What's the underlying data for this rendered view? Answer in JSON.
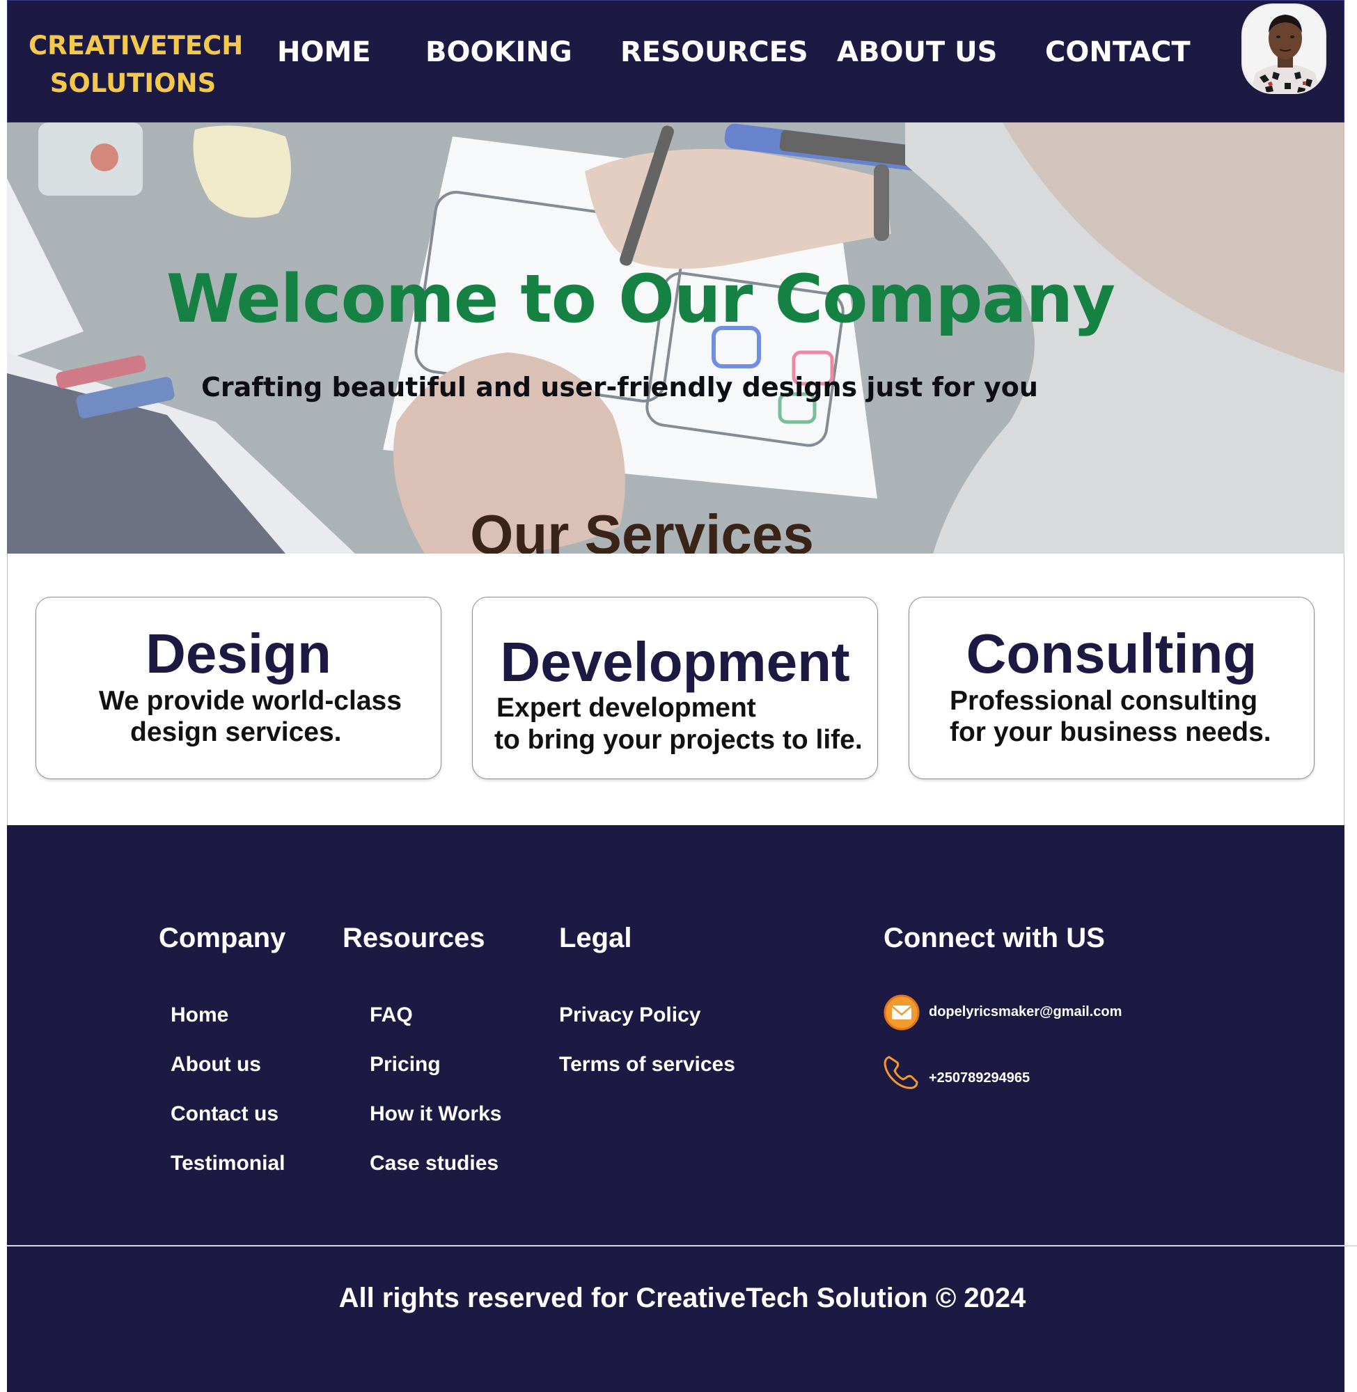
{
  "header": {
    "logo_line1": "CREATIVETECH",
    "logo_line2": "SOLUTIONS",
    "nav": [
      "HOME",
      "BOOKING",
      "RESOURCES",
      "ABOUT US",
      "CONTACT"
    ]
  },
  "hero": {
    "title": "Welcome to Our Company",
    "subtitle": "Crafting beautiful and user-friendly designs just for you"
  },
  "services": {
    "heading": "Our Services",
    "cards": [
      {
        "title": "Design",
        "desc_line1": "We provide world-class",
        "desc_line2": "design services."
      },
      {
        "title": "Development",
        "desc_line1": "Expert development",
        "desc_line2": "to bring your projects to life."
      },
      {
        "title": "Consulting",
        "desc_line1": "Professional consulting",
        "desc_line2": "for your business needs."
      }
    ]
  },
  "footer": {
    "company": {
      "title": "Company",
      "links": [
        "Home",
        "About us",
        "Contact us",
        "Testimonial"
      ]
    },
    "resources": {
      "title": "Resources",
      "links": [
        "FAQ",
        "Pricing",
        "How it Works",
        "Case studies"
      ]
    },
    "legal": {
      "title": "Legal",
      "links": [
        "Privacy Policy",
        "Terms of services"
      ]
    },
    "connect": {
      "title": "Connect with US",
      "email": "dopelyricsmaker@gmail.com",
      "phone": "+250789294965"
    },
    "copyright": "All rights reserved for CreativeTech Solution © 2024"
  },
  "colors": {
    "navy": "#1c1943",
    "logo_yellow": "#f4c94a",
    "hero_green": "#158143",
    "icon_orange": "#f29a2e"
  },
  "icons": [
    "avatar-photo",
    "email-icon",
    "phone-icon"
  ]
}
